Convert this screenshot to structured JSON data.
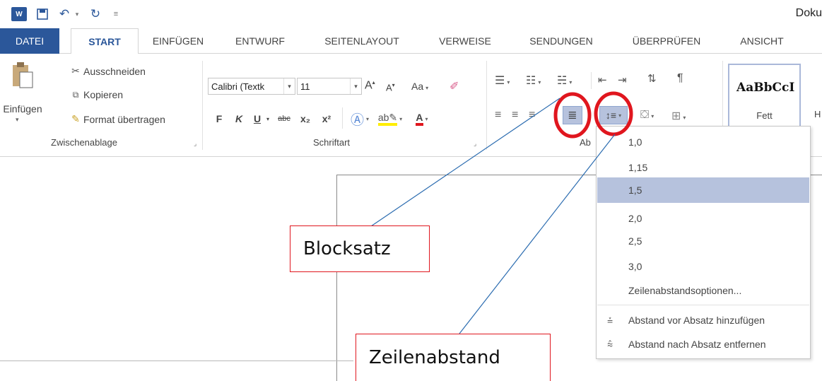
{
  "window": {
    "title": "Doku"
  },
  "quick_access": {
    "app_icon": "word-icon",
    "app_letter": "W",
    "save_icon": "save-icon",
    "undo_icon": "undo-icon",
    "redo_icon": "redo-icon",
    "customize_icon": "customize-icon"
  },
  "tabs": [
    {
      "label": "DATEI"
    },
    {
      "label": "START"
    },
    {
      "label": "EINFÜGEN"
    },
    {
      "label": "ENTWURF"
    },
    {
      "label": "SEITENLAYOUT"
    },
    {
      "label": "VERWEISE"
    },
    {
      "label": "SENDUNGEN"
    },
    {
      "label": "ÜBERPRÜFEN"
    },
    {
      "label": "ANSICHT"
    }
  ],
  "clipboard": {
    "group_label": "Zwischenablage",
    "paste_label": "Einfügen",
    "cut_label": "Ausschneiden",
    "copy_label": "Kopieren",
    "format_painter_label": "Format übertragen"
  },
  "font": {
    "group_label": "Schriftart",
    "font_name": "Calibri (Textk",
    "font_size": "11",
    "change_case_label": "Aa",
    "bold_label": "F",
    "italic_label": "K",
    "underline_label": "U",
    "strike_label": "abc",
    "subscript_label": "x₂",
    "superscript_label": "x²"
  },
  "paragraph": {
    "group_label": "Ab"
  },
  "styles": {
    "sample_text": "AaBbCcI",
    "style_name": "Fett",
    "next_letter": "H"
  },
  "line_spacing_menu": {
    "items": [
      {
        "label": "1,0",
        "selected": false
      },
      {
        "label": "1,15",
        "selected": false
      },
      {
        "label": "1,5",
        "selected": true
      },
      {
        "label": "2,0",
        "selected": false
      },
      {
        "label": "2,5",
        "selected": false
      },
      {
        "label": "3,0",
        "selected": false
      }
    ],
    "options_label": "Zeilenabstandsoptionen...",
    "add_space_before_label": "Abstand vor Absatz hinzufügen",
    "remove_space_after_label": "Abstand nach Absatz entfernen"
  },
  "callouts": {
    "justify": "Blocksatz",
    "line_spacing": "Zeilenabstand"
  },
  "colors": {
    "accent": "#2b579a",
    "highlight": "#b6c2dd",
    "callout_red": "#e0161e",
    "annotation_line": "#2b6cb0"
  }
}
